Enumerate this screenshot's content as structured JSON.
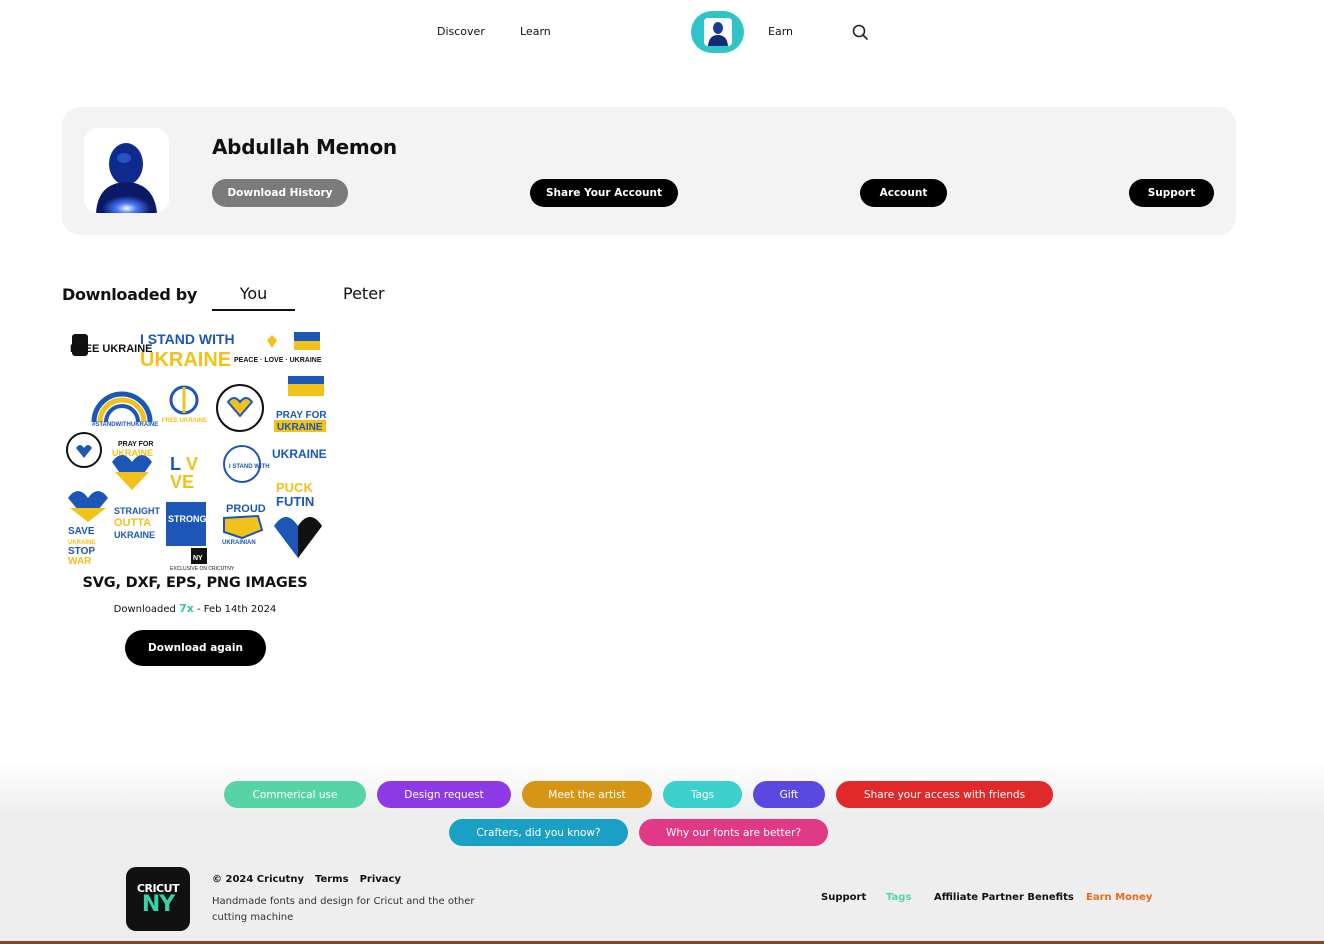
{
  "nav": {
    "discover": "Discover",
    "learn": "Learn",
    "earn": "Earn",
    "avatar_icon": "user-avatar-icon",
    "search_icon": "search-icon",
    "accent": "#2ec4c8"
  },
  "profile": {
    "name": "Abdullah Memon",
    "buttons": {
      "download_history": "Download History",
      "share_account": "Share Your Account",
      "account": "Account",
      "support": "Support"
    }
  },
  "downloaded_by": {
    "label": "Downloaded by",
    "tabs": [
      "You",
      "Peter"
    ],
    "active_tab": "You"
  },
  "download_item": {
    "caption": "SVG, DXF, EPS, PNG IMAGES",
    "downloaded_prefix": "Downloaded",
    "count": "7x",
    "date": "- Feb 14th 2024",
    "button": "Download again",
    "image_texts": [
      "FREE UKRAINE",
      "I STAND WITH UKRAINE",
      "PEACE LOVE UKRAINE",
      "#STANDWITHUKRAINE",
      "PRAY FOR UKRAINE",
      "UKRAINE",
      "PUCK FUTIN",
      "SAVE UKRAINE STOP WAR",
      "STRAIGHT OUTTA UKRAINE",
      "PROUD UKRAINIAN",
      "LOVE",
      "EXCLUSIVE ON CRICUTNY"
    ]
  },
  "footer": {
    "tags": [
      {
        "label": "Commerical use",
        "color": "#56d4a6"
      },
      {
        "label": "Design request",
        "color": "#8d3ae6"
      },
      {
        "label": "Meet the artist",
        "color": "#d79516"
      },
      {
        "label": "Tags",
        "color": "#3cd0cc"
      },
      {
        "label": "Gift",
        "color": "#5a48e0"
      },
      {
        "label": "Share your access with friends",
        "color": "#e02a2a"
      },
      {
        "label": "Crafters, did you know?",
        "color": "#1aa0c4"
      },
      {
        "label": "Why our fonts are better?",
        "color": "#e03a86"
      }
    ],
    "logo_line1": "CRICUT",
    "logo_line2": "NY",
    "copyright": "© 2024 Cricutny",
    "terms": "Terms",
    "privacy": "Privacy",
    "tagline": "Handmade fonts and design for Cricut and the other cutting machine",
    "links": {
      "support": "Support",
      "tags": "Tags",
      "affiliate": "Affiliate Partner Benefits",
      "earn_money": "Earn Money"
    },
    "link_colors": {
      "tags": "#56d4a6",
      "earn_money": "#e86a1a"
    }
  }
}
